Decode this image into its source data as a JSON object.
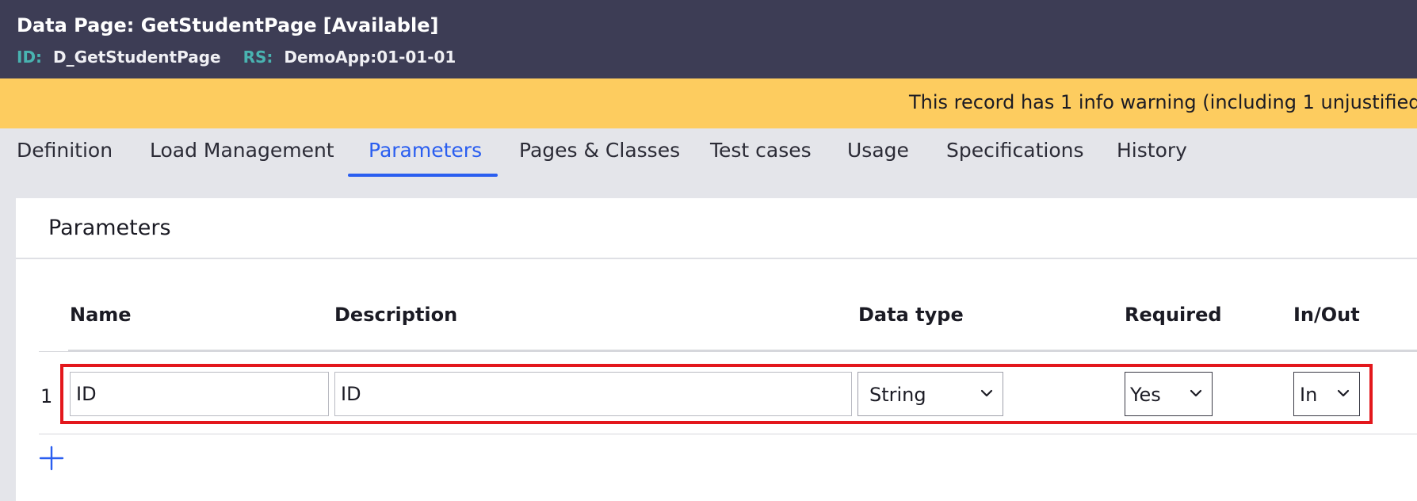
{
  "header": {
    "title": "Data Page: GetStudentPage",
    "status": "[Available]",
    "id_label": "ID:",
    "id_value": "D_GetStudentPage",
    "rs_label": "RS:",
    "rs_value": "DemoApp:01-01-01"
  },
  "warning": {
    "text": "This record has 1 info warning (including 1 unjustified"
  },
  "tabs": [
    {
      "label": "Definition"
    },
    {
      "label": "Load Management"
    },
    {
      "label": "Parameters",
      "active": true
    },
    {
      "label": "Pages & Classes"
    },
    {
      "label": "Test cases"
    },
    {
      "label": "Usage"
    },
    {
      "label": "Specifications"
    },
    {
      "label": "History"
    }
  ],
  "panel": {
    "title": "Parameters",
    "columns": [
      "Name",
      "Description",
      "Data type",
      "Required",
      "In/Out"
    ],
    "rows": [
      {
        "number": "1",
        "name": "ID",
        "description": "ID",
        "data_type": "String",
        "required": "Yes",
        "in_out": "In"
      }
    ]
  },
  "colors": {
    "header_bg": "#3d3d55",
    "meta_key": "#49b3b1",
    "warning_bg": "#fdcc5f",
    "accent": "#2a5ef0",
    "highlight": "#e3171c"
  },
  "icons": {
    "dropdown": "chevron-down-icon",
    "add": "plus-icon"
  }
}
